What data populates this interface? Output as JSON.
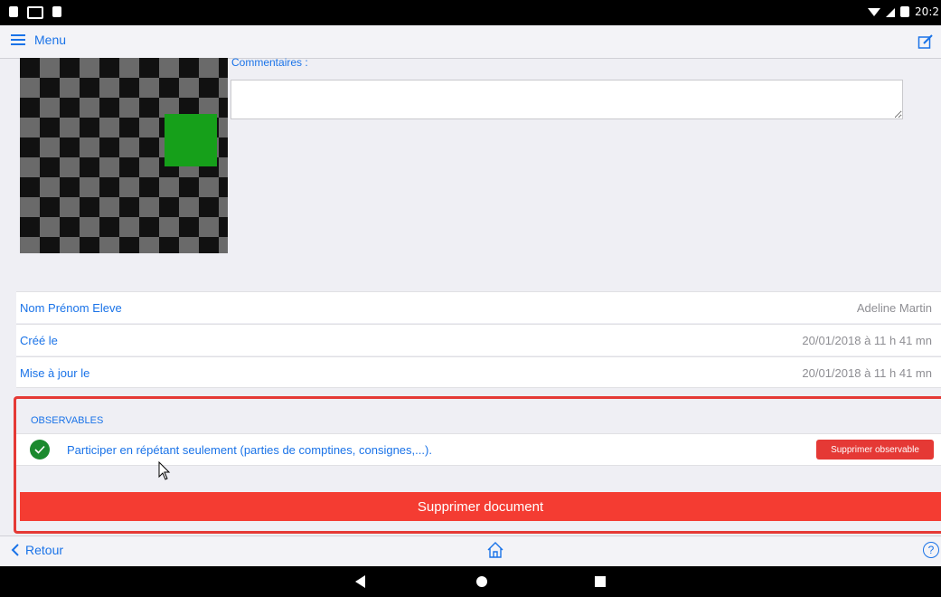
{
  "status_bar": {
    "time": "20:2"
  },
  "top_nav": {
    "menu_label": "Menu"
  },
  "comments": {
    "label": "Commentaires :",
    "value": ""
  },
  "info_rows": [
    {
      "label": "Nom Prénom Eleve",
      "value": "Adeline Martin"
    },
    {
      "label": "Créé le",
      "value": "20/01/2018 à 11 h 41 mn"
    },
    {
      "label": "Mise à jour le",
      "value": "20/01/2018 à 11 h 41 mn"
    }
  ],
  "observables": {
    "title": "OBSERVABLES",
    "items": [
      {
        "text": "Participer en répétant seulement (parties de comptines, consignes,...).",
        "delete_label": "Supprimer observable"
      }
    ]
  },
  "delete_document_label": "Supprimer document",
  "bottom_bar": {
    "back_label": "Retour",
    "help_glyph": "?"
  },
  "colors": {
    "accent": "#1a73e8",
    "danger": "#e53935",
    "success": "#1b8a2e"
  }
}
